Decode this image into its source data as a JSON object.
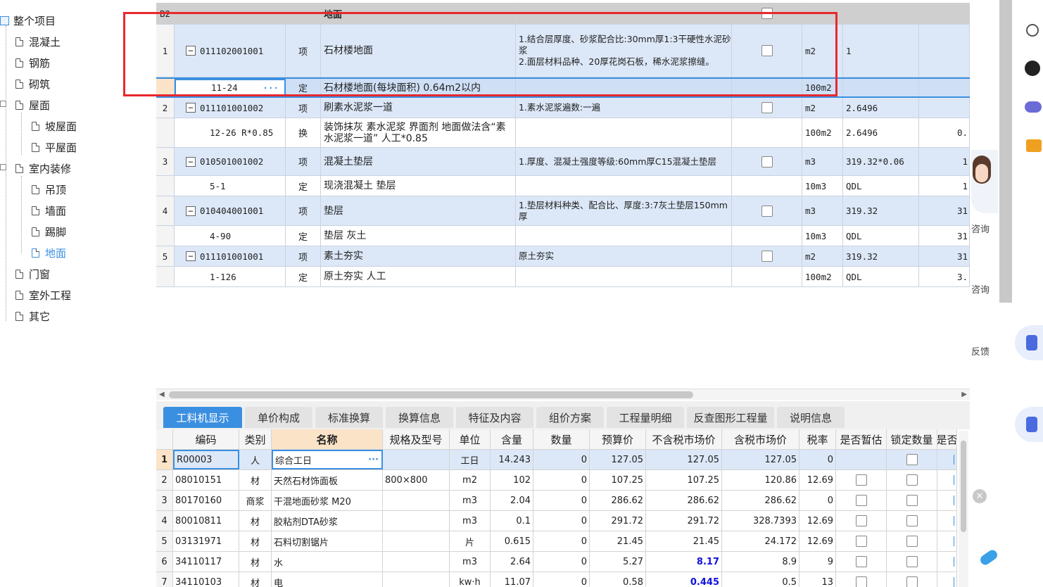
{
  "tree": {
    "root_label": "整个项目",
    "items": [
      {
        "label": "混凝土",
        "level": 1
      },
      {
        "label": "钢筋",
        "level": 1
      },
      {
        "label": "砌筑",
        "level": 1
      },
      {
        "label": "屋面",
        "level": 1
      },
      {
        "label": "坡屋面",
        "level": 2
      },
      {
        "label": "平屋面",
        "level": 2
      },
      {
        "label": "室内装修",
        "level": 1
      },
      {
        "label": "吊顶",
        "level": 2
      },
      {
        "label": "墙面",
        "level": 2
      },
      {
        "label": "踢脚",
        "level": 2
      },
      {
        "label": "地面",
        "level": 2,
        "active": true
      },
      {
        "label": "门窗",
        "level": 1
      },
      {
        "label": "室外工程",
        "level": 1
      },
      {
        "label": "其它",
        "level": 1
      }
    ]
  },
  "upper": {
    "section_row": {
      "num": "B2",
      "name": "地面"
    },
    "rows": [
      {
        "num": "1",
        "code": "011102001001",
        "type": "项",
        "name": "石材楼地面",
        "feature": "1.结合层厚度、砂浆配合比:30mm厚1:3干硬性水泥砂浆\n2.面层材料品种、20厚花岗石板，稀水泥浆擦缝。",
        "unit": "m2",
        "qty": "1",
        "extra": ""
      },
      {
        "num": "",
        "code": "11-24",
        "type": "定",
        "name": "石材楼地面(每块面积) 0.64m2以内",
        "feature": "",
        "unit": "100m2",
        "qty": "",
        "extra": ""
      },
      {
        "num": "2",
        "code": "011101001002",
        "type": "项",
        "name": "刷素水泥浆一道",
        "feature": "1.素水泥浆遍数:一遍",
        "unit": "m2",
        "qty": "2.6496",
        "extra": ""
      },
      {
        "num": "",
        "code": "12-26 R*0.85",
        "type": "换",
        "name": "装饰抹灰 素水泥浆 界面剂  地面做法含“素水泥浆一道” 人工*0.85",
        "feature": "",
        "unit": "100m2",
        "qty": "2.6496",
        "extra": "0."
      },
      {
        "num": "3",
        "code": "010501001002",
        "type": "项",
        "name": "混凝土垫层",
        "feature": "1.厚度、混凝土强度等级:60mm厚C15混凝土垫层",
        "unit": "m3",
        "qty": "319.32*0.06",
        "extra": "1"
      },
      {
        "num": "",
        "code": "5-1",
        "type": "定",
        "name": "现浇混凝土 垫层",
        "feature": "",
        "unit": "10m3",
        "qty": "QDL",
        "extra": "1"
      },
      {
        "num": "4",
        "code": "010404001001",
        "type": "项",
        "name": "垫层",
        "feature": "1.垫层材料种类、配合比、厚度:3:7灰土垫层150mm厚",
        "unit": "m3",
        "qty": "319.32",
        "extra": "31"
      },
      {
        "num": "",
        "code": "4-90",
        "type": "定",
        "name": "垫层 灰土",
        "feature": "",
        "unit": "10m3",
        "qty": "QDL",
        "extra": "31"
      },
      {
        "num": "5",
        "code": "011101001001",
        "type": "项",
        "name": "素土夯实",
        "feature": "原土夯实",
        "unit": "m2",
        "qty": "319.32",
        "extra": "31"
      },
      {
        "num": "",
        "code": "1-126",
        "type": "定",
        "name": "原土夯实 人工",
        "feature": "",
        "unit": "100m2",
        "qty": "QDL",
        "extra": "3."
      }
    ],
    "ellipsis": "···"
  },
  "tabs": [
    "工料机显示",
    "单价构成",
    "标准换算",
    "换算信息",
    "特征及内容",
    "组价方案",
    "工程量明细",
    "反查图形工程量",
    "说明信息"
  ],
  "lower": {
    "headers": [
      "编码",
      "类别",
      "名称",
      "规格及型号",
      "单位",
      "含量",
      "数量",
      "预算价",
      "不含税市场价",
      "含税市场价",
      "税率",
      "是否暂估",
      "锁定数量",
      "是否"
    ],
    "rows": [
      {
        "n": "1",
        "code": "R00003",
        "cat": "人",
        "name": "综合工日",
        "spec": "",
        "unit": "工日",
        "content": "14.243",
        "qty": "0",
        "budget": "127.05",
        "mkt": "127.05",
        "mkt_tax": "127.05",
        "rate": "0",
        "blue": false
      },
      {
        "n": "2",
        "code": "08010151",
        "cat": "材",
        "name": "天然石材饰面板",
        "spec": "800×800",
        "unit": "m2",
        "content": "102",
        "qty": "0",
        "budget": "107.25",
        "mkt": "107.25",
        "mkt_tax": "120.86",
        "rate": "12.69",
        "blue": false
      },
      {
        "n": "3",
        "code": "80170160",
        "cat": "商浆",
        "name": "干混地面砂浆 M20",
        "spec": "",
        "unit": "m3",
        "content": "2.04",
        "qty": "0",
        "budget": "286.62",
        "mkt": "286.62",
        "mkt_tax": "286.62",
        "rate": "0",
        "blue": false
      },
      {
        "n": "4",
        "code": "80010811",
        "cat": "材",
        "name": "胶粘剂DTA砂浆",
        "spec": "",
        "unit": "m3",
        "content": "0.1",
        "qty": "0",
        "budget": "291.72",
        "mkt": "291.72",
        "mkt_tax": "328.7393",
        "rate": "12.69",
        "blue": false
      },
      {
        "n": "5",
        "code": "03131971",
        "cat": "材",
        "name": "石料切割锯片",
        "spec": "",
        "unit": "片",
        "content": "0.615",
        "qty": "0",
        "budget": "21.45",
        "mkt": "21.45",
        "mkt_tax": "24.172",
        "rate": "12.69",
        "blue": false
      },
      {
        "n": "6",
        "code": "34110117",
        "cat": "材",
        "name": "水",
        "spec": "",
        "unit": "m3",
        "content": "2.64",
        "qty": "0",
        "budget": "5.27",
        "mkt": "8.17",
        "mkt_tax": "8.9",
        "rate": "9",
        "blue": true
      },
      {
        "n": "7",
        "code": "34110103",
        "cat": "材",
        "name": "电",
        "spec": "",
        "unit": "kw·h",
        "content": "11.07",
        "qty": "0",
        "budget": "0.58",
        "mkt": "0.445",
        "mkt_tax": "0.5",
        "rate": "13",
        "blue": true
      }
    ]
  },
  "assistant": {
    "consult1": "咨询",
    "consult2": "咨询",
    "feedback": "反馈"
  },
  "colors": {
    "accent": "#3b8fe0",
    "highlight": "#e8282d",
    "row_blue": "#dce8f8",
    "value_blue": "#1010e0"
  }
}
